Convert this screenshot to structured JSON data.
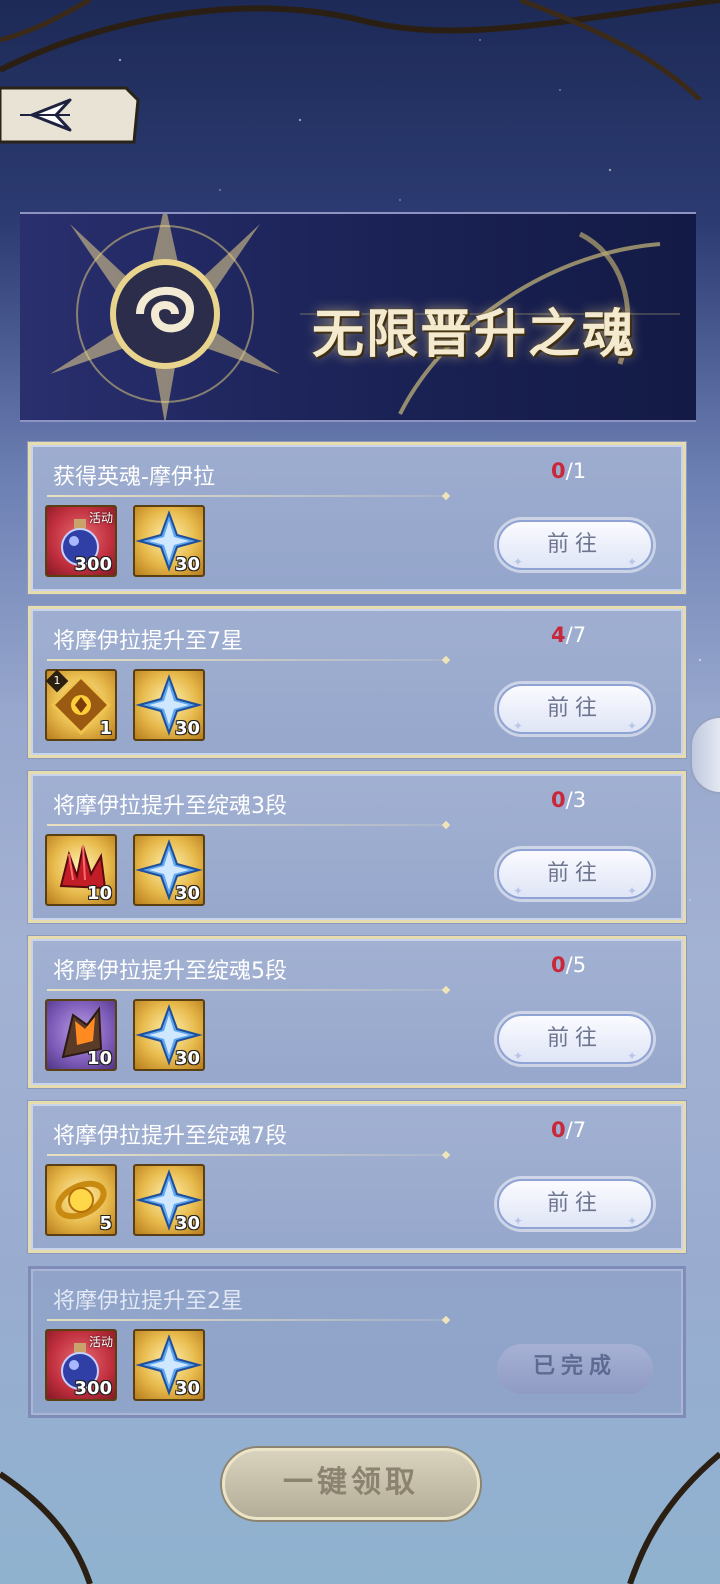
{
  "banner": {
    "title": "无限晋升之魂"
  },
  "back": {
    "label": "back"
  },
  "tasks": [
    {
      "title": "获得英魂-摩伊拉",
      "current": "0",
      "total": "/1",
      "button": "前往",
      "rewards": [
        {
          "icon": "red-potion-icon",
          "qty": "300",
          "tag": "活动"
        },
        {
          "icon": "blue-star-crystal-icon",
          "qty": "30"
        }
      ]
    },
    {
      "title": "将摩伊拉提升至7星",
      "current": "4",
      "total": "/7",
      "button": "前往",
      "rewards": [
        {
          "icon": "golden-rune-card-icon",
          "qty": "1",
          "level": "1"
        },
        {
          "icon": "blue-star-crystal-icon",
          "qty": "30"
        }
      ]
    },
    {
      "title": "将摩伊拉提升至绽魂3段",
      "current": "0",
      "total": "/3",
      "button": "前往",
      "rewards": [
        {
          "icon": "red-crystal-cluster-icon",
          "qty": "10"
        },
        {
          "icon": "blue-star-crystal-icon",
          "qty": "30"
        }
      ]
    },
    {
      "title": "将摩伊拉提升至绽魂5段",
      "current": "0",
      "total": "/5",
      "button": "前往",
      "rewards": [
        {
          "icon": "fire-crystal-icon",
          "qty": "10"
        },
        {
          "icon": "blue-star-crystal-icon",
          "qty": "30"
        }
      ]
    },
    {
      "title": "将摩伊拉提升至绽魂7段",
      "current": "0",
      "total": "/7",
      "button": "前往",
      "rewards": [
        {
          "icon": "golden-orb-icon",
          "qty": "5"
        },
        {
          "icon": "blue-star-crystal-icon",
          "qty": "30"
        }
      ]
    },
    {
      "title": "将摩伊拉提升至2星",
      "current": "",
      "total": "",
      "button": "已完成",
      "rewards": [
        {
          "icon": "red-potion-icon",
          "qty": "300",
          "tag": "活动"
        },
        {
          "icon": "blue-star-crystal-icon",
          "qty": "30"
        }
      ]
    }
  ],
  "claim_all": {
    "label": "一键领取"
  },
  "colors": {
    "progress_current": "#c8283a",
    "card_border": "#e6dcae",
    "banner_bg": "#1c2459"
  }
}
